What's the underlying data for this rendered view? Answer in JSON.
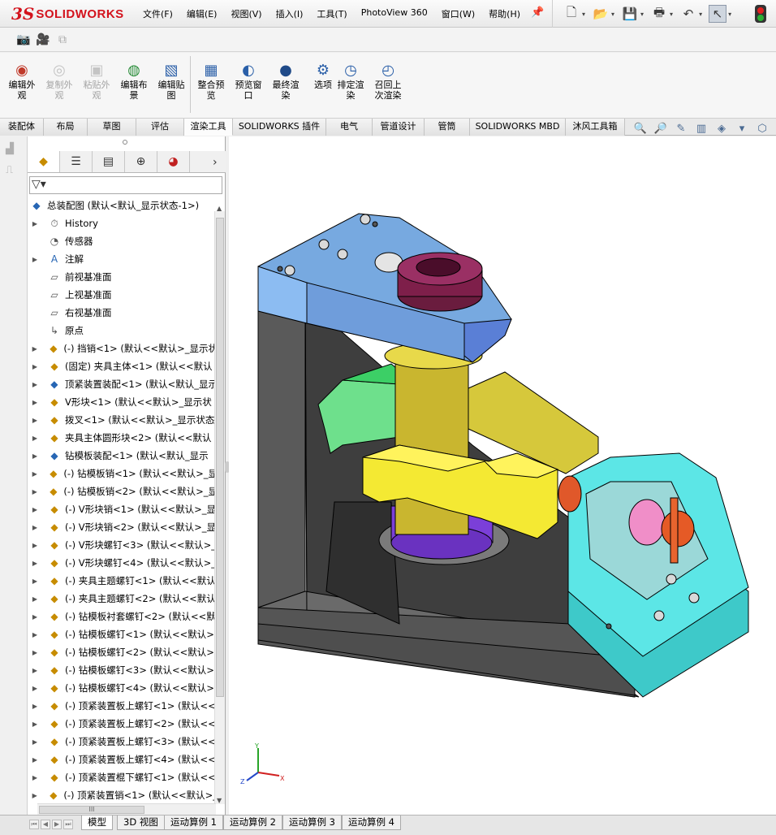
{
  "app": {
    "brand_ds": "3S",
    "brand_name": "SOLIDWORKS"
  },
  "menu": [
    "文件(F)",
    "编辑(E)",
    "视图(V)",
    "插入(I)",
    "工具(T)",
    "PhotoView 360",
    "窗口(W)",
    "帮助(H)"
  ],
  "ribbon": {
    "buttons": [
      {
        "label": "编辑外\n观",
        "icon": "appearance-icon",
        "enabled": true
      },
      {
        "label": "复制外\n观",
        "icon": "copy-appearance-icon",
        "enabled": false
      },
      {
        "label": "粘贴外\n观",
        "icon": "paste-appearance-icon",
        "enabled": false
      },
      {
        "label": "编辑布\n景",
        "icon": "scene-icon",
        "enabled": true
      },
      {
        "label": "编辑贴\n图",
        "icon": "decal-icon",
        "enabled": true
      },
      {
        "label": "整合预\n览",
        "icon": "integrated-preview-icon",
        "enabled": true
      },
      {
        "label": "预览窗\n口",
        "icon": "preview-window-icon",
        "enabled": true
      },
      {
        "label": "最终渲\n染",
        "icon": "final-render-icon",
        "enabled": true
      },
      {
        "label": "选项",
        "icon": "options-icon",
        "enabled": true
      },
      {
        "label": "排定渲\n染",
        "icon": "schedule-render-icon",
        "enabled": true
      },
      {
        "label": "召回上\n次渲染",
        "icon": "recall-render-icon",
        "enabled": true
      }
    ]
  },
  "command_tabs": [
    "装配体",
    "布局",
    "草图",
    "评估",
    "渲染工具",
    "SOLIDWORKS 插件",
    "电气",
    "管道设计",
    "管筒",
    "SOLIDWORKS MBD",
    "沐风工具箱"
  ],
  "active_command_tab": "渲染工具",
  "tree": {
    "root": "总装配图  (默认<默认_显示状态-1>)",
    "items": [
      {
        "label": "History",
        "type": "history",
        "expand": true
      },
      {
        "label": "传感器",
        "type": "sensor",
        "expand": false
      },
      {
        "label": "注解",
        "type": "annotation",
        "expand": true
      },
      {
        "label": "前视基准面",
        "type": "plane",
        "expand": false
      },
      {
        "label": "上视基准面",
        "type": "plane",
        "expand": false
      },
      {
        "label": "右视基准面",
        "type": "plane",
        "expand": false
      },
      {
        "label": "原点",
        "type": "origin",
        "expand": false
      },
      {
        "label": "(-) 挡销<1> (默认<<默认>_显示状",
        "type": "part",
        "expand": true
      },
      {
        "label": "(固定) 夹具主体<1> (默认<<默认",
        "type": "part",
        "expand": true
      },
      {
        "label": "顶紧装置装配<1> (默认<默认_显示",
        "type": "asm",
        "expand": true
      },
      {
        "label": "V形块<1> (默认<<默认>_显示状",
        "type": "part",
        "expand": true
      },
      {
        "label": "拨叉<1> (默认<<默认>_显示状态",
        "type": "part",
        "expand": true
      },
      {
        "label": "夹具主体圆形块<2> (默认<<默认",
        "type": "part",
        "expand": true
      },
      {
        "label": "钻模板装配<1> (默认<默认_显示",
        "type": "asm",
        "expand": true
      },
      {
        "label": "(-) 钻模板销<1> (默认<<默认>_显",
        "type": "part",
        "expand": true
      },
      {
        "label": "(-) 钻模板销<2> (默认<<默认>_显",
        "type": "part",
        "expand": true
      },
      {
        "label": "(-) V形块销<1> (默认<<默认>_显",
        "type": "part",
        "expand": true
      },
      {
        "label": "(-) V形块销<2> (默认<<默认>_显",
        "type": "part",
        "expand": true
      },
      {
        "label": "(-) V形块螺钉<3> (默认<<默认>_",
        "type": "part",
        "expand": true
      },
      {
        "label": "(-) V形块螺钉<4> (默认<<默认>_",
        "type": "part",
        "expand": true
      },
      {
        "label": "(-) 夹具主题螺钉<1> (默认<<默认",
        "type": "part",
        "expand": true
      },
      {
        "label": "(-) 夹具主题螺钉<2> (默认<<默认",
        "type": "part",
        "expand": true
      },
      {
        "label": "(-) 钻模板衬套螺钉<2> (默认<<默",
        "type": "part",
        "expand": true
      },
      {
        "label": "(-) 钻模板螺钉<1> (默认<<默认>",
        "type": "part",
        "expand": true
      },
      {
        "label": "(-) 钻模板螺钉<2> (默认<<默认>",
        "type": "part",
        "expand": true
      },
      {
        "label": "(-) 钻模板螺钉<3> (默认<<默认>",
        "type": "part",
        "expand": true
      },
      {
        "label": "(-) 钻模板螺钉<4> (默认<<默认>",
        "type": "part",
        "expand": true
      },
      {
        "label": "(-) 顶紧装置板上螺钉<1> (默认<<",
        "type": "part",
        "expand": true
      },
      {
        "label": "(-) 顶紧装置板上螺钉<2> (默认<<",
        "type": "part",
        "expand": true
      },
      {
        "label": "(-) 顶紧装置板上螺钉<3> (默认<<",
        "type": "part",
        "expand": true
      },
      {
        "label": "(-) 顶紧装置板上螺钉<4> (默认<<",
        "type": "part",
        "expand": true
      },
      {
        "label": "(-) 顶紧装置棍下螺钉<1> (默认<<",
        "type": "part",
        "expand": true
      },
      {
        "label": "(-) 顶紧装置销<1> (默认<<默认>_",
        "type": "part",
        "expand": true
      }
    ]
  },
  "triad": {
    "x": "X",
    "y": "Y",
    "z": "Z"
  },
  "hscroll_label": "III",
  "bottom_tabs": [
    "模型",
    "3D 视图",
    "运动算例 1",
    "运动算例 2",
    "运动算例 3",
    "运动算例 4"
  ],
  "active_bottom_tab": "模型"
}
